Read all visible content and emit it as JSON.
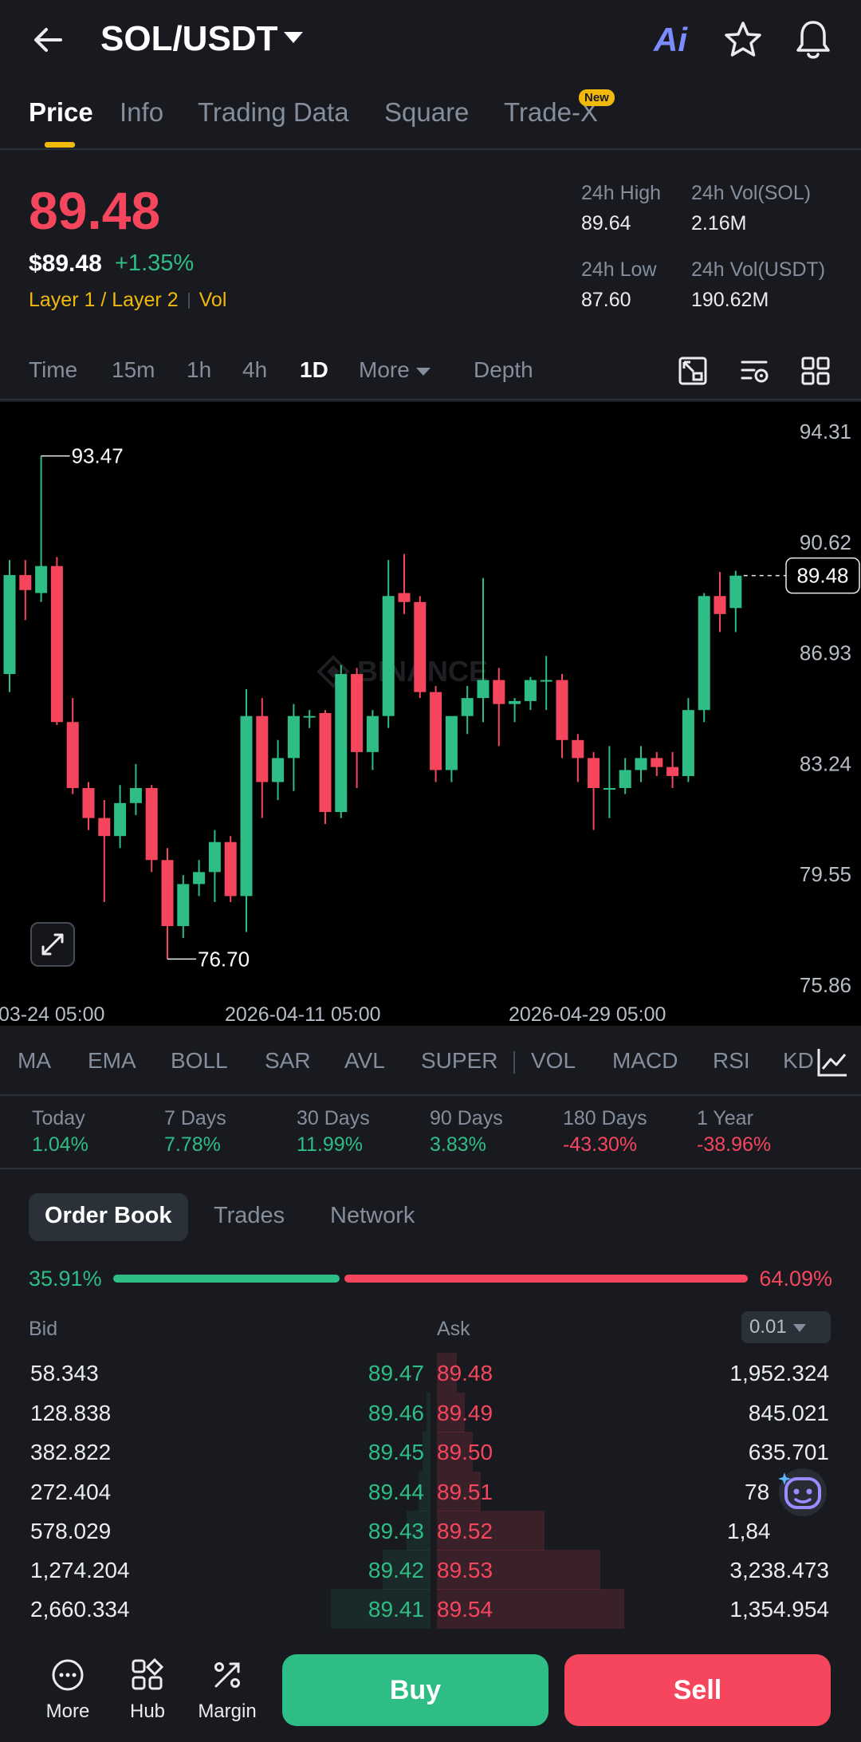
{
  "header": {
    "pair": "SOL/USDT",
    "ai_label": "Ai"
  },
  "tabs": [
    {
      "label": "Price"
    },
    {
      "label": "Info"
    },
    {
      "label": "Trading Data"
    },
    {
      "label": "Square"
    },
    {
      "label": "Trade-X",
      "badge": "New"
    }
  ],
  "price": {
    "last": "89.48",
    "usd": "$89.48",
    "change": "+1.35%",
    "tag1": "Layer 1 / Layer 2",
    "tag2": "Vol"
  },
  "stats": {
    "high_label": "24h High",
    "high": "89.64",
    "vol_base_label": "24h Vol(SOL)",
    "vol_base": "2.16M",
    "low_label": "24h Low",
    "low": "87.60",
    "vol_quote_label": "24h Vol(USDT)",
    "vol_quote": "190.62M"
  },
  "intervals": {
    "time": "Time",
    "m15": "15m",
    "h1": "1h",
    "h4": "4h",
    "d1": "1D",
    "more": "More",
    "depth": "Depth"
  },
  "chart_data": {
    "type": "candlestick",
    "y_ticks": [
      "94.31",
      "90.62",
      "86.93",
      "83.24",
      "79.55",
      "75.86"
    ],
    "ylim": [
      75.86,
      94.31
    ],
    "x_labels": [
      "03-24 05:00",
      "2026-04-11 05:00",
      "2026-04-29 05:00"
    ],
    "high_marker": "93.47",
    "low_marker": "76.70",
    "last_price_label": "89.48",
    "watermark": "BINANCE",
    "candles": [
      {
        "o": 86.2,
        "h": 90.0,
        "l": 85.6,
        "c": 89.5
      },
      {
        "o": 89.5,
        "h": 90.0,
        "l": 88.0,
        "c": 89.0
      },
      {
        "o": 88.9,
        "h": 93.47,
        "l": 88.6,
        "c": 89.8
      },
      {
        "o": 89.8,
        "h": 90.1,
        "l": 84.5,
        "c": 84.6
      },
      {
        "o": 84.6,
        "h": 85.4,
        "l": 82.2,
        "c": 82.4
      },
      {
        "o": 82.4,
        "h": 82.6,
        "l": 81.0,
        "c": 81.4
      },
      {
        "o": 81.4,
        "h": 82.0,
        "l": 78.6,
        "c": 80.8
      },
      {
        "o": 80.8,
        "h": 82.5,
        "l": 80.4,
        "c": 81.9
      },
      {
        "o": 81.9,
        "h": 83.2,
        "l": 81.5,
        "c": 82.4
      },
      {
        "o": 82.4,
        "h": 82.5,
        "l": 79.6,
        "c": 80.0
      },
      {
        "o": 80.0,
        "h": 80.4,
        "l": 76.7,
        "c": 77.8
      },
      {
        "o": 77.8,
        "h": 79.5,
        "l": 77.4,
        "c": 79.2
      },
      {
        "o": 79.2,
        "h": 80.0,
        "l": 78.8,
        "c": 79.6
      },
      {
        "o": 79.6,
        "h": 81.0,
        "l": 78.6,
        "c": 80.6
      },
      {
        "o": 80.6,
        "h": 80.8,
        "l": 78.6,
        "c": 78.8
      },
      {
        "o": 78.8,
        "h": 85.7,
        "l": 77.6,
        "c": 84.8
      },
      {
        "o": 84.8,
        "h": 85.4,
        "l": 81.4,
        "c": 82.6
      },
      {
        "o": 82.6,
        "h": 84.0,
        "l": 82.0,
        "c": 83.4
      },
      {
        "o": 83.4,
        "h": 85.2,
        "l": 82.3,
        "c": 84.8
      },
      {
        "o": 84.8,
        "h": 85.0,
        "l": 84.4,
        "c": 84.8
      },
      {
        "o": 84.9,
        "h": 85.0,
        "l": 81.2,
        "c": 81.6
      },
      {
        "o": 81.6,
        "h": 86.5,
        "l": 81.4,
        "c": 86.2
      },
      {
        "o": 86.2,
        "h": 86.4,
        "l": 82.4,
        "c": 83.6
      },
      {
        "o": 83.6,
        "h": 85.0,
        "l": 83.0,
        "c": 84.8
      },
      {
        "o": 84.8,
        "h": 90.0,
        "l": 84.4,
        "c": 88.8
      },
      {
        "o": 88.9,
        "h": 90.2,
        "l": 88.2,
        "c": 88.6
      },
      {
        "o": 88.6,
        "h": 88.8,
        "l": 85.4,
        "c": 85.6
      },
      {
        "o": 85.6,
        "h": 85.8,
        "l": 82.6,
        "c": 83.0
      },
      {
        "o": 83.0,
        "h": 84.6,
        "l": 82.6,
        "c": 84.8
      },
      {
        "o": 84.8,
        "h": 85.8,
        "l": 84.2,
        "c": 85.4
      },
      {
        "o": 85.4,
        "h": 89.4,
        "l": 84.6,
        "c": 86.0
      },
      {
        "o": 86.0,
        "h": 86.4,
        "l": 83.8,
        "c": 85.2
      },
      {
        "o": 85.2,
        "h": 85.4,
        "l": 84.6,
        "c": 85.3
      },
      {
        "o": 85.3,
        "h": 86.1,
        "l": 85.0,
        "c": 86.0
      },
      {
        "o": 86.0,
        "h": 86.8,
        "l": 85.0,
        "c": 86.0
      },
      {
        "o": 86.0,
        "h": 86.2,
        "l": 83.4,
        "c": 84.0
      },
      {
        "o": 84.0,
        "h": 84.2,
        "l": 82.6,
        "c": 83.4
      },
      {
        "o": 83.4,
        "h": 83.6,
        "l": 81.0,
        "c": 82.4
      },
      {
        "o": 82.4,
        "h": 83.8,
        "l": 81.4,
        "c": 82.4
      },
      {
        "o": 82.4,
        "h": 83.4,
        "l": 82.2,
        "c": 83.0
      },
      {
        "o": 83.0,
        "h": 83.8,
        "l": 82.6,
        "c": 83.4
      },
      {
        "o": 83.4,
        "h": 83.6,
        "l": 82.8,
        "c": 83.1
      },
      {
        "o": 83.1,
        "h": 83.6,
        "l": 82.4,
        "c": 82.8
      },
      {
        "o": 82.8,
        "h": 85.4,
        "l": 82.6,
        "c": 85.0
      },
      {
        "o": 85.0,
        "h": 88.9,
        "l": 84.6,
        "c": 88.8
      },
      {
        "o": 88.8,
        "h": 89.6,
        "l": 87.6,
        "c": 88.2
      },
      {
        "o": 88.4,
        "h": 89.64,
        "l": 87.6,
        "c": 89.48
      }
    ]
  },
  "indicators": [
    "MA",
    "EMA",
    "BOLL",
    "SAR",
    "AVL",
    "SUPER",
    "VOL",
    "MACD",
    "RSI",
    "KD"
  ],
  "performance": [
    {
      "label": "Today",
      "value": "1.04%",
      "dir": "up"
    },
    {
      "label": "7 Days",
      "value": "7.78%",
      "dir": "up"
    },
    {
      "label": "30 Days",
      "value": "11.99%",
      "dir": "up"
    },
    {
      "label": "90 Days",
      "value": "3.83%",
      "dir": "up"
    },
    {
      "label": "180 Days",
      "value": "-43.30%",
      "dir": "down"
    },
    {
      "label": "1 Year",
      "value": "-38.96%",
      "dir": "down"
    }
  ],
  "orderbook": {
    "tabs": [
      "Order Book",
      "Trades",
      "Network"
    ],
    "bid_ratio": "35.91%",
    "ask_ratio": "64.09%",
    "bid_fraction": 0.3591,
    "bid_label": "Bid",
    "ask_label": "Ask",
    "precision": "0.01",
    "rows": [
      {
        "bid_qty": "58.343",
        "bid_price": "89.47",
        "ask_price": "89.48",
        "ask_qty": "1,952.324",
        "bid_depth": 0.0,
        "ask_depth": 0.05
      },
      {
        "bid_qty": "128.838",
        "bid_price": "89.46",
        "ask_price": "89.49",
        "ask_qty": "845.021",
        "bid_depth": 0.01,
        "ask_depth": 0.07
      },
      {
        "bid_qty": "382.822",
        "bid_price": "89.45",
        "ask_price": "89.50",
        "ask_qty": "635.701",
        "bid_depth": 0.02,
        "ask_depth": 0.09
      },
      {
        "bid_qty": "272.404",
        "bid_price": "89.44",
        "ask_price": "89.51",
        "ask_qty": "78",
        "bid_depth": 0.03,
        "ask_depth": 0.11
      },
      {
        "bid_qty": "578.029",
        "bid_price": "89.43",
        "ask_price": "89.52",
        "ask_qty": "1,84",
        "bid_depth": 0.06,
        "ask_depth": 0.27
      },
      {
        "bid_qty": "1,274.204",
        "bid_price": "89.42",
        "ask_price": "89.53",
        "ask_qty": "3,238.473",
        "bid_depth": 0.12,
        "ask_depth": 0.41
      },
      {
        "bid_qty": "2,660.334",
        "bid_price": "89.41",
        "ask_price": "89.54",
        "ask_qty": "1,354.954",
        "bid_depth": 0.25,
        "ask_depth": 0.47
      }
    ]
  },
  "bottom": {
    "more": "More",
    "hub": "Hub",
    "margin": "Margin",
    "buy": "Buy",
    "sell": "Sell"
  },
  "colors": {
    "up": "#2ebd85",
    "down": "#f6465d",
    "accent": "#f0b90b",
    "background": "#181a20"
  }
}
